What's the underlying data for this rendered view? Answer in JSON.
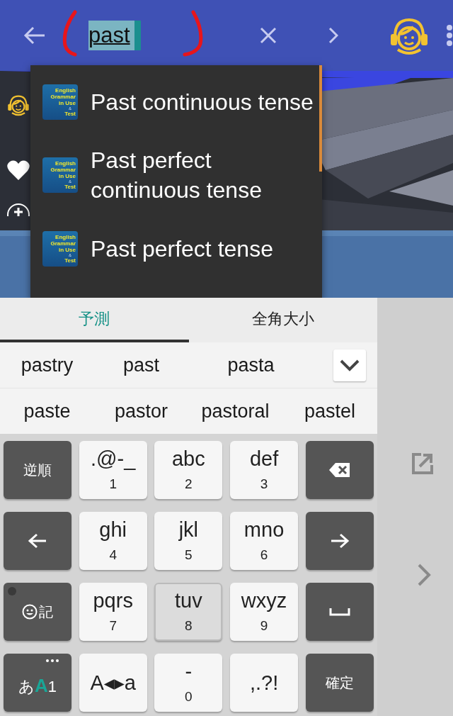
{
  "top_bar": {
    "search": {
      "value": "past"
    }
  },
  "suggestions": [
    {
      "icon_lines": [
        "English",
        "Grammar",
        "in Use",
        "&",
        "Test"
      ],
      "label": "Past continuous tense"
    },
    {
      "icon_lines": [
        "English",
        "Grammar",
        "in Use",
        "&",
        "Test"
      ],
      "label": "Past perfect continuous tense"
    },
    {
      "icon_lines": [
        "English",
        "Grammar",
        "in Use",
        "&",
        "Test"
      ],
      "label": "Past perfect tense"
    }
  ],
  "keyboard": {
    "tabs": [
      {
        "label": "予測",
        "selected": true
      },
      {
        "label": "全角大小",
        "selected": false
      }
    ],
    "candidates": [
      [
        "pastry",
        "past",
        "pasta"
      ],
      [
        "paste",
        "pastor",
        "pastoral",
        "pastel"
      ]
    ],
    "keys": [
      [
        {
          "kind": "label",
          "label": "逆順"
        },
        {
          "kind": "char",
          "main": ".@-_",
          "sub": "1",
          "pressed": false
        },
        {
          "kind": "char",
          "main": "abc",
          "sub": "2",
          "pressed": false
        },
        {
          "kind": "char",
          "main": "def",
          "sub": "3",
          "pressed": false
        },
        {
          "kind": "delete"
        }
      ],
      [
        {
          "kind": "back"
        },
        {
          "kind": "char",
          "main": "ghi",
          "sub": "4",
          "pressed": false
        },
        {
          "kind": "char",
          "main": "jkl",
          "sub": "5",
          "pressed": false
        },
        {
          "kind": "char",
          "main": "mno",
          "sub": "6",
          "pressed": false
        },
        {
          "kind": "forward"
        }
      ],
      [
        {
          "kind": "emoji",
          "label": "記"
        },
        {
          "kind": "char",
          "main": "pqrs",
          "sub": "7",
          "pressed": false
        },
        {
          "kind": "char",
          "main": "tuv",
          "sub": "8",
          "pressed": true
        },
        {
          "kind": "char",
          "main": "wxyz",
          "sub": "9",
          "pressed": false
        },
        {
          "kind": "space"
        }
      ],
      [
        {
          "kind": "mode",
          "modes": [
            {
              "label": "あ",
              "selected": false
            },
            {
              "label": "A",
              "selected": true
            },
            {
              "label": "1",
              "selected": false
            }
          ]
        },
        {
          "kind": "char",
          "main": "A◂▸a",
          "pressed": false
        },
        {
          "kind": "char",
          "main": "-",
          "sub": "0",
          "pressed": false
        },
        {
          "kind": "char",
          "main": ",.?!",
          "pressed": false
        },
        {
          "kind": "label",
          "label": "確定"
        }
      ]
    ]
  }
}
